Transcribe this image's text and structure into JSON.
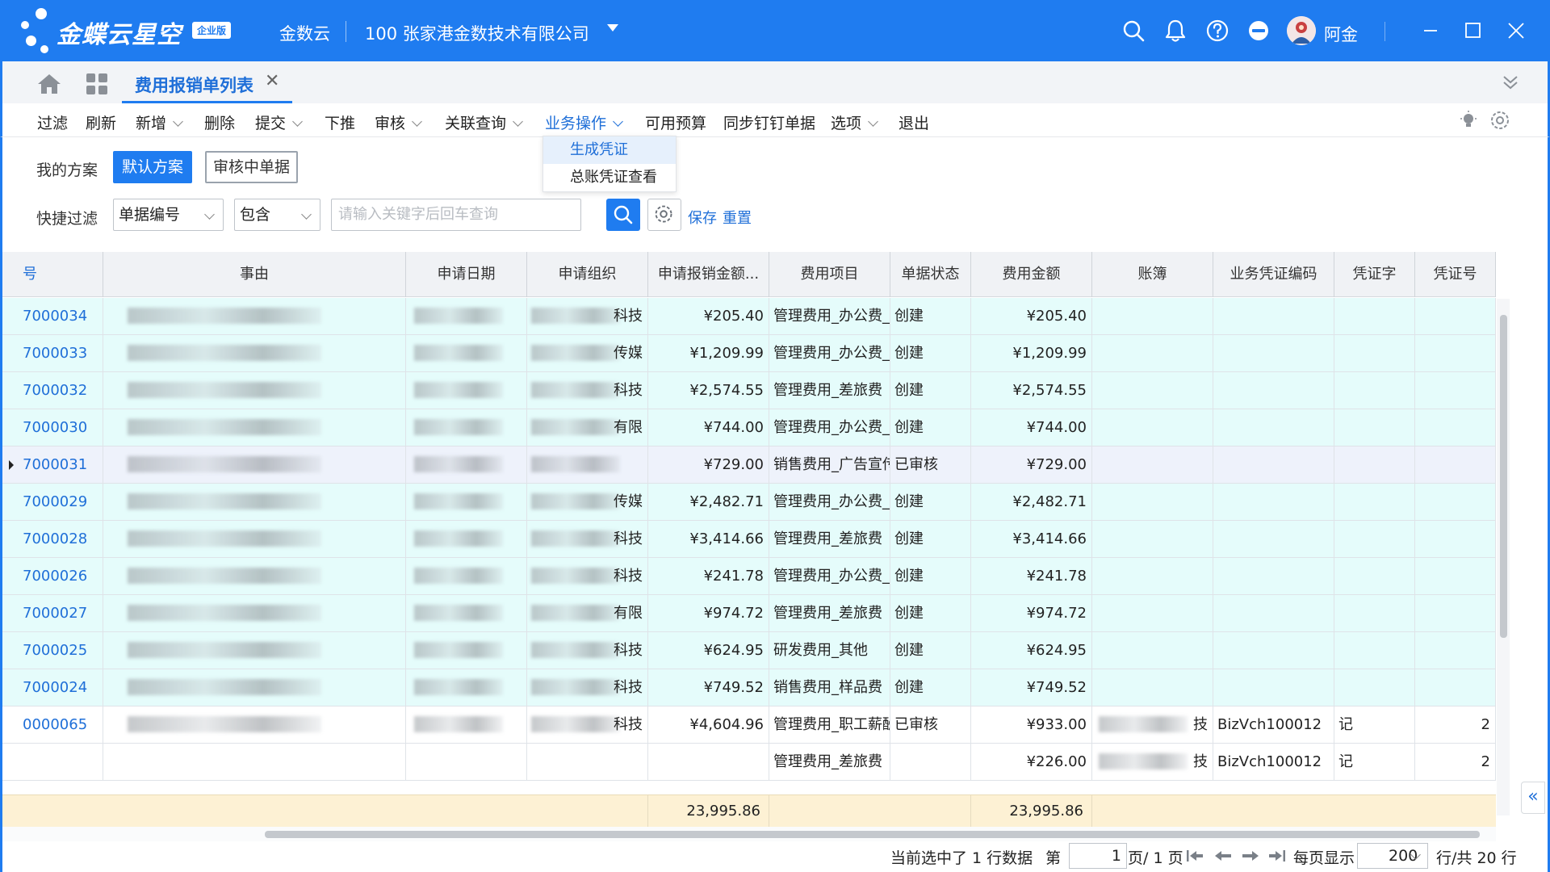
{
  "app": {
    "brand": "金蝶云星空",
    "edition": "企业版",
    "nav_link": "金数云",
    "company": "100  张家港金数技术有限公司",
    "user_name": "阿金",
    "accent_color": "#1f7cf0"
  },
  "tabs": [
    {
      "label": "费用报销单列表",
      "active": true
    }
  ],
  "toolbar": {
    "items": [
      "过滤",
      "刷新",
      "新增",
      "删除",
      "提交",
      "下推",
      "审核",
      "关联查询",
      "业务操作",
      "可用预算",
      "同步钉钉单据",
      "选项",
      "退出"
    ]
  },
  "dropdown": {
    "items": [
      "生成凭证",
      "总账凭证查看"
    ],
    "hover_index": 0
  },
  "filter": {
    "scheme_label": "我的方案",
    "schemes": [
      "默认方案",
      "审核中单据"
    ],
    "quick_label": "快捷过滤",
    "field": "单据编号",
    "operator": "包含",
    "search_placeholder": "请输入关键字后回车查询",
    "save_label": "保存",
    "reset_label": "重置"
  },
  "grid": {
    "columns": [
      "号",
      "事由",
      "申请日期",
      "申请组织",
      "申请报销金额...",
      "费用项目",
      "单据状态",
      "费用金额",
      "账簿",
      "业务凭证编码",
      "凭证字",
      "凭证号"
    ],
    "rows": [
      {
        "no": "7000034",
        "org_suffix": "科技",
        "amount": "¥205.40",
        "item": "管理费用_办公费_",
        "status": "创建",
        "fee": "¥205.40",
        "book_suffix": "",
        "vcode": "",
        "vword": "",
        "vno": ""
      },
      {
        "no": "7000033",
        "org_suffix": "传媒",
        "amount": "¥1,209.99",
        "item": "管理费用_办公费_",
        "status": "创建",
        "fee": "¥1,209.99",
        "book_suffix": "",
        "vcode": "",
        "vword": "",
        "vno": ""
      },
      {
        "no": "7000032",
        "org_suffix": "科技",
        "amount": "¥2,574.55",
        "item": "管理费用_差旅费",
        "status": "创建",
        "fee": "¥2,574.55",
        "book_suffix": "",
        "vcode": "",
        "vword": "",
        "vno": ""
      },
      {
        "no": "7000030",
        "org_suffix": "有限",
        "amount": "¥744.00",
        "item": "管理费用_办公费_",
        "status": "创建",
        "fee": "¥744.00",
        "book_suffix": "",
        "vcode": "",
        "vword": "",
        "vno": ""
      },
      {
        "no": "7000031",
        "org_suffix": "",
        "amount": "¥729.00",
        "item": "销售费用_广告宣传",
        "status": "已审核",
        "fee": "¥729.00",
        "book_suffix": "",
        "vcode": "",
        "vword": "",
        "vno": ""
      },
      {
        "no": "7000029",
        "org_suffix": "传媒",
        "amount": "¥2,482.71",
        "item": "管理费用_办公费_",
        "status": "创建",
        "fee": "¥2,482.71",
        "book_suffix": "",
        "vcode": "",
        "vword": "",
        "vno": ""
      },
      {
        "no": "7000028",
        "org_suffix": "科技",
        "amount": "¥3,414.66",
        "item": "管理费用_差旅费",
        "status": "创建",
        "fee": "¥3,414.66",
        "book_suffix": "",
        "vcode": "",
        "vword": "",
        "vno": ""
      },
      {
        "no": "7000026",
        "org_suffix": "科技",
        "amount": "¥241.78",
        "item": "管理费用_办公费_",
        "status": "创建",
        "fee": "¥241.78",
        "book_suffix": "",
        "vcode": "",
        "vword": "",
        "vno": ""
      },
      {
        "no": "7000027",
        "org_suffix": "有限",
        "amount": "¥974.72",
        "item": "管理费用_差旅费",
        "status": "创建",
        "fee": "¥974.72",
        "book_suffix": "",
        "vcode": "",
        "vword": "",
        "vno": ""
      },
      {
        "no": "7000025",
        "org_suffix": "科技",
        "amount": "¥624.95",
        "item": "研发费用_其他",
        "status": "创建",
        "fee": "¥624.95",
        "book_suffix": "",
        "vcode": "",
        "vword": "",
        "vno": ""
      },
      {
        "no": "7000024",
        "org_suffix": "科技",
        "amount": "¥749.52",
        "item": "销售费用_样品费",
        "status": "创建",
        "fee": "¥749.52",
        "book_suffix": "",
        "vcode": "",
        "vword": "",
        "vno": ""
      },
      {
        "no": "0000065",
        "org_suffix": "科技",
        "amount": "¥4,604.96",
        "item": "管理费用_职工薪酬",
        "status": "已审核",
        "fee": "¥933.00",
        "book_suffix": "技",
        "vcode": "BizVch100012",
        "vword": "记",
        "vno": "2"
      },
      {
        "no": "",
        "org_suffix": "",
        "amount": "",
        "item": "管理费用_差旅费",
        "status": "",
        "fee": "¥226.00",
        "book_suffix": "技",
        "vcode": "BizVch100012",
        "vword": "记",
        "vno": "2"
      }
    ],
    "totals": {
      "amount": "23,995.86",
      "fee": "23,995.86"
    }
  },
  "footer": {
    "selected_text": "当前选中了 1 行数据",
    "page_prefix": "第",
    "page_value": "1",
    "page_suffix": "页/ 1 页",
    "per_page_label": "每页显示",
    "per_page_value": "200",
    "total_text": "行/共 20 行"
  }
}
